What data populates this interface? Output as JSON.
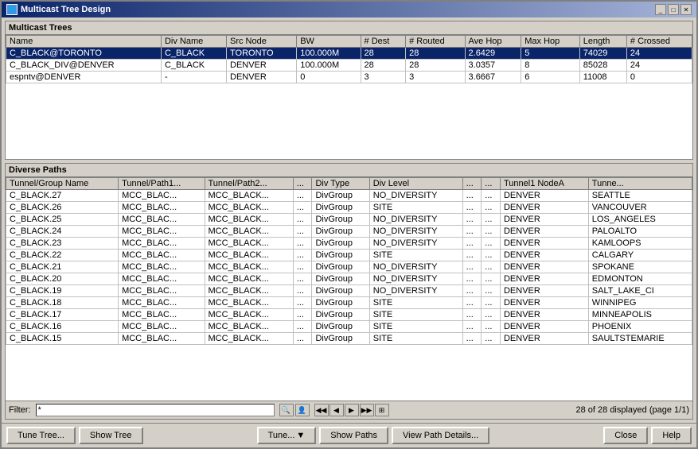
{
  "window": {
    "title": "Multicast Tree Design",
    "title_icon": "🌐"
  },
  "title_buttons": {
    "minimize": "_",
    "maximize": "□",
    "close": "✕"
  },
  "multicast_trees": {
    "section_label": "Multicast Trees",
    "columns": [
      "Name",
      "Div Name",
      "Src Node",
      "BW",
      "# Dest",
      "# Routed",
      "Ave Hop",
      "Max Hop",
      "Length",
      "# Crossed"
    ],
    "rows": [
      [
        "C_BLACK@TORONTO",
        "C_BLACK",
        "TORONTO",
        "100.000M",
        "28",
        "28",
        "2.6429",
        "5",
        "74029",
        "24"
      ],
      [
        "C_BLACK_DIV@DENVER",
        "C_BLACK",
        "DENVER",
        "100.000M",
        "28",
        "28",
        "3.0357",
        "8",
        "85028",
        "24"
      ],
      [
        "espntv@DENVER",
        "-",
        "DENVER",
        "0",
        "3",
        "3",
        "3.6667",
        "6",
        "11008",
        "0"
      ]
    ]
  },
  "diverse_paths": {
    "section_label": "Diverse Paths",
    "columns": [
      "Tunnel/Group Name",
      "Tunnel/Path1...",
      "Tunnel/Path2...",
      "...",
      "Div Type",
      "Div Level",
      "...",
      "...",
      "Tunnel1 NodeA",
      "Tunne..."
    ],
    "rows": [
      [
        "C_BLACK.27",
        "MCC_BLAC...",
        "MCC_BLACK...",
        "...",
        "DivGroup",
        "NO_DIVERSITY",
        "...",
        "...",
        "DENVER",
        "SEATTLE"
      ],
      [
        "C_BLACK.26",
        "MCC_BLAC...",
        "MCC_BLACK...",
        "...",
        "DivGroup",
        "SITE",
        "...",
        "...",
        "DENVER",
        "VANCOUVER"
      ],
      [
        "C_BLACK.25",
        "MCC_BLAC...",
        "MCC_BLACK...",
        "...",
        "DivGroup",
        "NO_DIVERSITY",
        "...",
        "...",
        "DENVER",
        "LOS_ANGELES"
      ],
      [
        "C_BLACK.24",
        "MCC_BLAC...",
        "MCC_BLACK...",
        "...",
        "DivGroup",
        "NO_DIVERSITY",
        "...",
        "...",
        "DENVER",
        "PALOALTO"
      ],
      [
        "C_BLACK.23",
        "MCC_BLAC...",
        "MCC_BLACK...",
        "...",
        "DivGroup",
        "NO_DIVERSITY",
        "...",
        "...",
        "DENVER",
        "KAMLOOPS"
      ],
      [
        "C_BLACK.22",
        "MCC_BLAC...",
        "MCC_BLACK...",
        "...",
        "DivGroup",
        "SITE",
        "...",
        "...",
        "DENVER",
        "CALGARY"
      ],
      [
        "C_BLACK.21",
        "MCC_BLAC...",
        "MCC_BLACK...",
        "...",
        "DivGroup",
        "NO_DIVERSITY",
        "...",
        "...",
        "DENVER",
        "SPOKANE"
      ],
      [
        "C_BLACK.20",
        "MCC_BLAC...",
        "MCC_BLACK...",
        "...",
        "DivGroup",
        "NO_DIVERSITY",
        "...",
        "...",
        "DENVER",
        "EDMONTON"
      ],
      [
        "C_BLACK.19",
        "MCC_BLAC...",
        "MCC_BLACK...",
        "...",
        "DivGroup",
        "NO_DIVERSITY",
        "...",
        "...",
        "DENVER",
        "SALT_LAKE_CI"
      ],
      [
        "C_BLACK.18",
        "MCC_BLAC...",
        "MCC_BLACK...",
        "...",
        "DivGroup",
        "SITE",
        "...",
        "...",
        "DENVER",
        "WINNIPEG"
      ],
      [
        "C_BLACK.17",
        "MCC_BLAC...",
        "MCC_BLACK...",
        "...",
        "DivGroup",
        "SITE",
        "...",
        "...",
        "DENVER",
        "MINNEAPOLIS"
      ],
      [
        "C_BLACK.16",
        "MCC_BLAC...",
        "MCC_BLACK...",
        "...",
        "DivGroup",
        "SITE",
        "...",
        "...",
        "DENVER",
        "PHOENIX"
      ],
      [
        "C_BLACK.15",
        "MCC_BLAC...",
        "MCC_BLACK...",
        "...",
        "DivGroup",
        "SITE",
        "...",
        "...",
        "DENVER",
        "SAULTSTEMARIE"
      ]
    ]
  },
  "filter": {
    "label": "Filter:",
    "value": "*",
    "page_info": "28 of 28 displayed (page 1/1)"
  },
  "buttons": {
    "tune_tree": "Tune Tree...",
    "show_tree": "Show Tree",
    "tune": "Tune...",
    "show_paths": "Show Paths",
    "view_path_details": "View Path Details...",
    "close": "Close",
    "help": "Help"
  }
}
